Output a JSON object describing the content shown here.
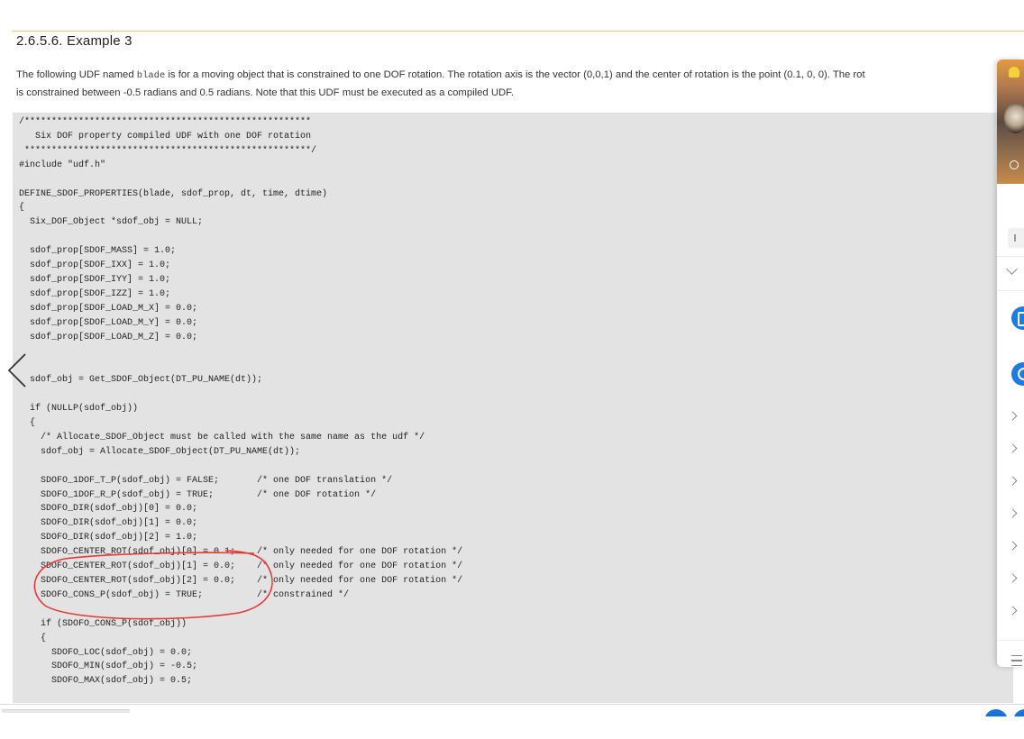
{
  "section": {
    "title": "2.6.5.6. Example 3"
  },
  "intro": {
    "line1_before": "The following UDF named ",
    "line1_code": "blade",
    "line1_after": " is for a moving object that is constrained to one DOF rotation. The rotation axis is the vector (0,0,1) and the center of rotation is the point (0.1, 0, 0). The rot",
    "line2": "is constrained between -0.5 radians and 0.5 radians. Note that this UDF must be executed as a compiled UDF."
  },
  "code": {
    "text": "/*****************************************************\n   Six DOF property compiled UDF with one DOF rotation\n *****************************************************/\n#include \"udf.h\"\n\nDEFINE_SDOF_PROPERTIES(blade, sdof_prop, dt, time, dtime)\n{\n  Six_DOF_Object *sdof_obj = NULL;\n\n  sdof_prop[SDOF_MASS] = 1.0;\n  sdof_prop[SDOF_IXX] = 1.0;\n  sdof_prop[SDOF_IYY] = 1.0;\n  sdof_prop[SDOF_IZZ] = 1.0;\n  sdof_prop[SDOF_LOAD_M_X] = 0.0;\n  sdof_prop[SDOF_LOAD_M_Y] = 0.0;\n  sdof_prop[SDOF_LOAD_M_Z] = 0.0;\n\n\n  sdof_obj = Get_SDOF_Object(DT_PU_NAME(dt));\n\n  if (NULLP(sdof_obj))\n  {\n    /* Allocate_SDOF_Object must be called with the same name as the udf */\n    sdof_obj = Allocate_SDOF_Object(DT_PU_NAME(dt));\n\n    SDOFO_1DOF_T_P(sdof_obj) = FALSE;       /* one DOF translation */\n    SDOFO_1DOF_R_P(sdof_obj) = TRUE;        /* one DOF rotation */\n    SDOFO_DIR(sdof_obj)[0] = 0.0;\n    SDOFO_DIR(sdof_obj)[1] = 0.0;\n    SDOFO_DIR(sdof_obj)[2] = 1.0;\n    SDOFO_CENTER_ROT(sdof_obj)[0] = 0.1;    /* only needed for one DOF rotation */\n    SDOFO_CENTER_ROT(sdof_obj)[1] = 0.0;    /* only needed for one DOF rotation */\n    SDOFO_CENTER_ROT(sdof_obj)[2] = 0.0;    /* only needed for one DOF rotation */\n    SDOFO_CONS_P(sdof_obj) = TRUE;          /* constrained */\n\n    if (SDOFO_CONS_P(sdof_obj))\n    {\n      SDOFO_LOC(sdof_obj) = 0.0;\n      SDOFO_MIN(sdof_obj) = -0.5;\n      SDOFO_MAX(sdof_obj) = 0.5;"
  },
  "colors": {
    "annotation": "#e53935",
    "code_background": "#e3e3e3",
    "title_rule": "#e5c96a"
  },
  "icons": {
    "prev": "chevron-left-icon",
    "side_menu": "hamburger-icon",
    "side_rows": "chevron-right-icon"
  }
}
